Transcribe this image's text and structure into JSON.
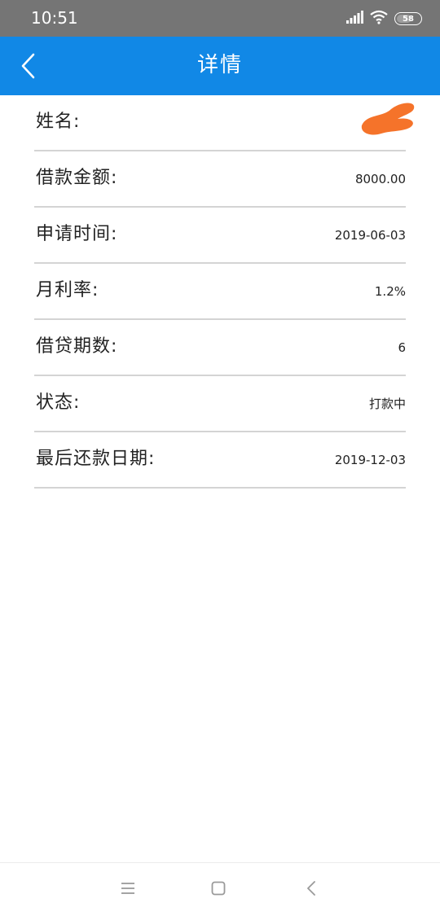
{
  "status_bar": {
    "time": "10:51",
    "battery_level": "58",
    "icons": [
      "signal-icon",
      "wifi-icon",
      "battery-icon"
    ]
  },
  "app_bar": {
    "title": "详情",
    "back_icon": "back-chevron-icon",
    "background_color": "#1188e6"
  },
  "details": [
    {
      "label": "姓名:",
      "value": ""
    },
    {
      "label": "借款金额:",
      "value": "8000.00"
    },
    {
      "label": "申请时间:",
      "value": "2019-06-03"
    },
    {
      "label": "月利率:",
      "value": "1.2%"
    },
    {
      "label": "借贷期数:",
      "value": "6"
    },
    {
      "label": "状态:",
      "value": "打款中"
    },
    {
      "label": "最后还款日期:",
      "value": "2019-12-03"
    }
  ],
  "redaction_color": "#f5732a",
  "nav_bar": {
    "icons": [
      "menu-icon",
      "home-square-icon",
      "back-icon"
    ]
  }
}
